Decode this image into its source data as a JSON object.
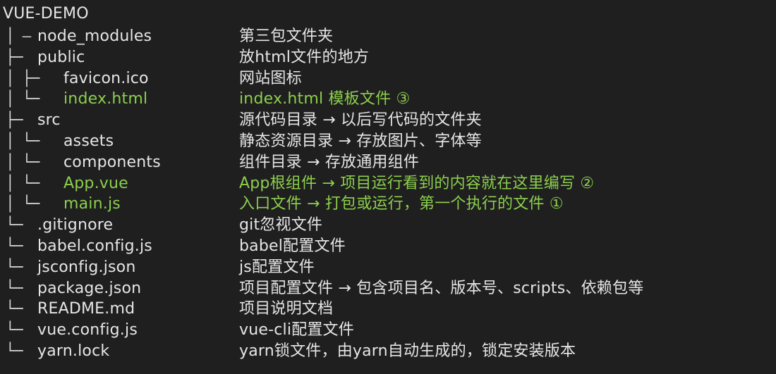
{
  "title": "VUE-DEMO",
  "rows": [
    {
      "prefix": "│ —",
      "name": "node_modules",
      "desc": "第三包文件夹",
      "highlight": false
    },
    {
      "prefix": "├─",
      "name": "public",
      "desc": "放html文件的地方",
      "highlight": false
    },
    {
      "prefix": "│   ├─",
      "name": "favicon.ico",
      "desc": "网站图标",
      "highlight": false
    },
    {
      "prefix": "│   └─",
      "name": "index.html",
      "desc": "index.html 模板文件 ③",
      "highlight": true
    },
    {
      "prefix": "├─",
      "name": "src",
      "desc": "源代码目录 → 以后写代码的文件夹",
      "highlight": false
    },
    {
      "prefix": "│   └─",
      "name": "assets",
      "desc": "静态资源目录 → 存放图片、字体等",
      "highlight": false
    },
    {
      "prefix": "│   └─",
      "name": "components",
      "desc": "组件目录 → 存放通用组件",
      "highlight": false
    },
    {
      "prefix": "│   └─",
      "name": "App.vue",
      "desc": "App根组件 → 项目运行看到的内容就在这里编写 ②",
      "highlight": true
    },
    {
      "prefix": "│   └─",
      "name": "main.js",
      "desc": "入口文件 → 打包或运行，第一个执行的文件 ①",
      "highlight": true
    },
    {
      "prefix": "└─",
      "name": ".gitignore",
      "desc": "git忽视文件",
      "highlight": false
    },
    {
      "prefix": "└─",
      "name": "babel.config.js",
      "desc": "babel配置文件",
      "highlight": false
    },
    {
      "prefix": "└─",
      "name": "jsconfig.json",
      "desc": "js配置文件",
      "highlight": false
    },
    {
      "prefix": "└─",
      "name": "package.json",
      "desc": "项目配置文件 → 包含项目名、版本号、scripts、依赖包等",
      "highlight": false
    },
    {
      "prefix": "└─",
      "name": "README.md",
      "desc": "项目说明文档",
      "highlight": false
    },
    {
      "prefix": "└─",
      "name": "vue.config.js",
      "desc": "vue-cli配置文件",
      "highlight": false
    },
    {
      "prefix": "└─",
      "name": "yarn.lock",
      "desc": "yarn锁文件，由yarn自动生成的，锁定安装版本",
      "highlight": false
    }
  ],
  "colors": {
    "background": "#1f1f1f",
    "text": "#e6e6e6",
    "highlight": "#8ccf4d",
    "tree_line": "#cfcfcf"
  }
}
